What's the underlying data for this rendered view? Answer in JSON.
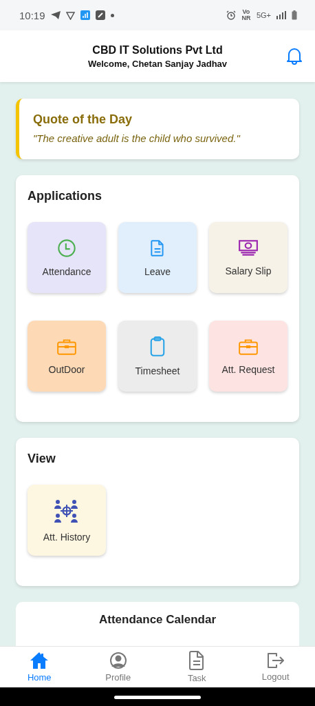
{
  "status_bar": {
    "time": "10:19",
    "volte": "Vo NR",
    "network": "5G+"
  },
  "header": {
    "title": "CBD IT Solutions Pvt Ltd",
    "subtitle": "Welcome, Chetan Sanjay Jadhav"
  },
  "quote": {
    "title": "Quote of the Day",
    "text": "\"The creative adult is the child who survived.\""
  },
  "applications": {
    "title": "Applications",
    "items": [
      {
        "label": "Attendance",
        "kind": "clock",
        "color": "#e6e4f8"
      },
      {
        "label": "Leave",
        "kind": "document",
        "color": "#e1effc"
      },
      {
        "label": "Salary Slip",
        "kind": "money",
        "color": "#f6f2e7"
      },
      {
        "label": "OutDoor",
        "kind": "briefcase",
        "color": "#fdd9b5"
      },
      {
        "label": "Timesheet",
        "kind": "clipboard",
        "color": "#ececec"
      },
      {
        "label": "Att. Request",
        "kind": "briefcase",
        "color": "#fde3e1"
      }
    ]
  },
  "view": {
    "title": "View",
    "items": [
      {
        "label": "Att. History",
        "kind": "people",
        "color": "#fdf6e1"
      }
    ]
  },
  "calendar": {
    "title": "Attendance Calendar"
  },
  "bottom_nav": [
    {
      "label": "Home",
      "kind": "home",
      "selected": true
    },
    {
      "label": "Profile",
      "kind": "profile",
      "selected": false
    },
    {
      "label": "Task",
      "kind": "task",
      "selected": false
    },
    {
      "label": "Logout",
      "kind": "logout",
      "selected": false
    }
  ]
}
